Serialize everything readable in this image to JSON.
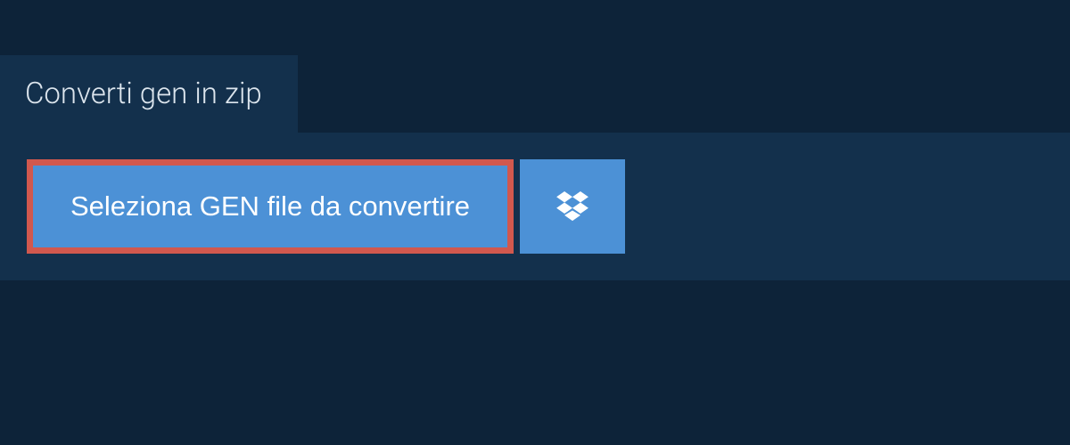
{
  "tab": {
    "title": "Converti gen in zip"
  },
  "actions": {
    "select_file_label": "Seleziona GEN file da convertire"
  },
  "colors": {
    "background": "#0d2339",
    "panel": "#13304c",
    "button": "#4c91d6",
    "highlight_border": "#d1584e",
    "text_light": "#dce5ed",
    "text_white": "#ffffff"
  }
}
